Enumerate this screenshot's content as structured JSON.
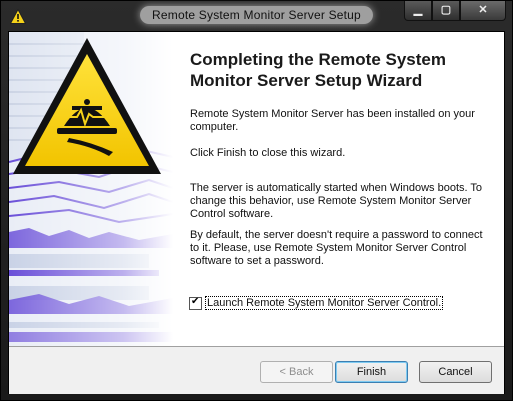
{
  "window": {
    "title": "Remote System Monitor Server Setup",
    "icon": "warning-triangle-icon",
    "controls": {
      "minimize": "minimize-icon",
      "maximize": "maximize-icon",
      "close": "close-icon"
    }
  },
  "sidebar": {
    "image": "warning-triangle-with-server-monitor-graphic",
    "colors": {
      "yellow": "#f5d21a",
      "black": "#111111",
      "purple": "#6a4fd8"
    }
  },
  "main": {
    "heading": "Completing the Remote System Monitor Server Setup Wizard",
    "paragraphs": [
      "Remote System Monitor Server has been installed on your computer.",
      "Click Finish to close this wizard.",
      "The server is automatically started when Windows boots. To change this behavior, use Remote System Monitor Server Control software.",
      "By default, the server doesn't require a password to connect to it. Please, use Remote System Monitor Server Control software to set a password."
    ],
    "launch_checkbox": {
      "label": "Launch Remote System Monitor Server Control.",
      "checked": true
    }
  },
  "buttons": {
    "back": "< Back",
    "finish": "Finish",
    "cancel": "Cancel"
  }
}
